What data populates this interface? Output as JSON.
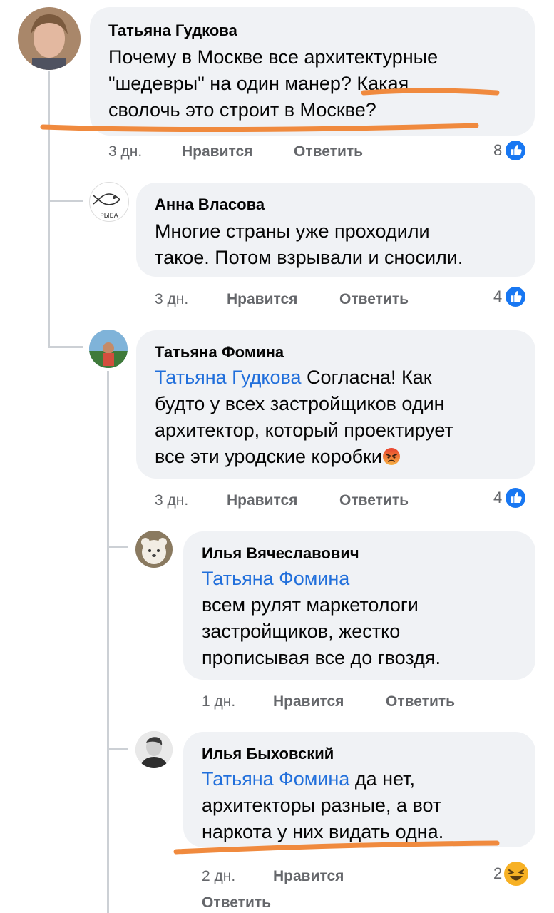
{
  "comments": [
    {
      "author": "Татьяна Гудкова",
      "text_lines": [
        "Почему в Москве все архитектурные",
        "\"шедевры\" на один манер? Какая",
        "сволочь это строит в Москве?"
      ],
      "time": "3 дн.",
      "like_label": "Нравится",
      "reply_label": "Ответить",
      "reaction_count": "8",
      "reaction_icon": "like-icon"
    },
    {
      "author": "Анна Власова",
      "text_lines": [
        "Многие страны уже проходили",
        "такое.  Потом взрывали и сносили."
      ],
      "time": "3 дн.",
      "like_label": "Нравится",
      "reply_label": "Ответить",
      "reaction_count": "4",
      "reaction_icon": "like-icon"
    },
    {
      "author": "Татьяна Фомина",
      "mention": "Татьяна Гудкова",
      "text_first": " Согласна! Как",
      "text_lines": [
        "будто у всех застройщиков один",
        "архитектор, который проектирует",
        "все эти уродские коробки"
      ],
      "emoji": "angry-face-emoji",
      "time": "3 дн.",
      "like_label": "Нравится",
      "reply_label": "Ответить",
      "reaction_count": "4",
      "reaction_icon": "like-icon"
    },
    {
      "author": "Илья Вячеславович",
      "mention": "Татьяна Фомина",
      "text_lines": [
        "всем рулят маркетологи",
        "застройщиков, жестко",
        "прописывая все до гвоздя."
      ],
      "time": "1 дн.",
      "like_label": "Нравится",
      "reply_label": "Ответить"
    },
    {
      "author": "Илья Быховский",
      "mention": "Татьяна Фомина",
      "text_first": " да нет,",
      "text_lines": [
        "архитекторы разные, а вот",
        "наркота у них видать одна."
      ],
      "time": "2 дн.",
      "like_label": "Нравится",
      "reply_label": "Ответить",
      "reaction_count": "2",
      "reaction_icon": "haha-icon"
    }
  ],
  "colors": {
    "mention": "#216fdb",
    "bubble": "#f0f2f5",
    "meta": "#65676b",
    "like": "#1877f2",
    "annotation": "#f08a3e"
  }
}
